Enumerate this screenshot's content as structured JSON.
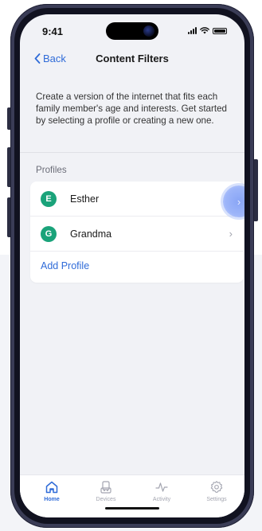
{
  "status_bar": {
    "time": "9:41"
  },
  "nav": {
    "back_label": "Back",
    "title": "Content Filters"
  },
  "description": "Create a version of the internet that fits each family member's age and interests. Get started by selecting a profile or creating a new one.",
  "profiles_section": {
    "title": "Profiles",
    "items": [
      {
        "initial": "E",
        "name": "Esther"
      },
      {
        "initial": "G",
        "name": "Grandma"
      }
    ],
    "add_label": "Add Profile"
  },
  "tab_bar": {
    "tabs": [
      {
        "label": "Home",
        "icon": "home-icon",
        "active": true
      },
      {
        "label": "Devices",
        "icon": "devices-icon",
        "active": false
      },
      {
        "label": "Activity",
        "icon": "activity-icon",
        "active": false
      },
      {
        "label": "Settings",
        "icon": "settings-icon",
        "active": false
      }
    ]
  },
  "colors": {
    "accent": "#2f6bd8",
    "avatar": "#1aa37a",
    "highlight": "#8aa6f6"
  }
}
